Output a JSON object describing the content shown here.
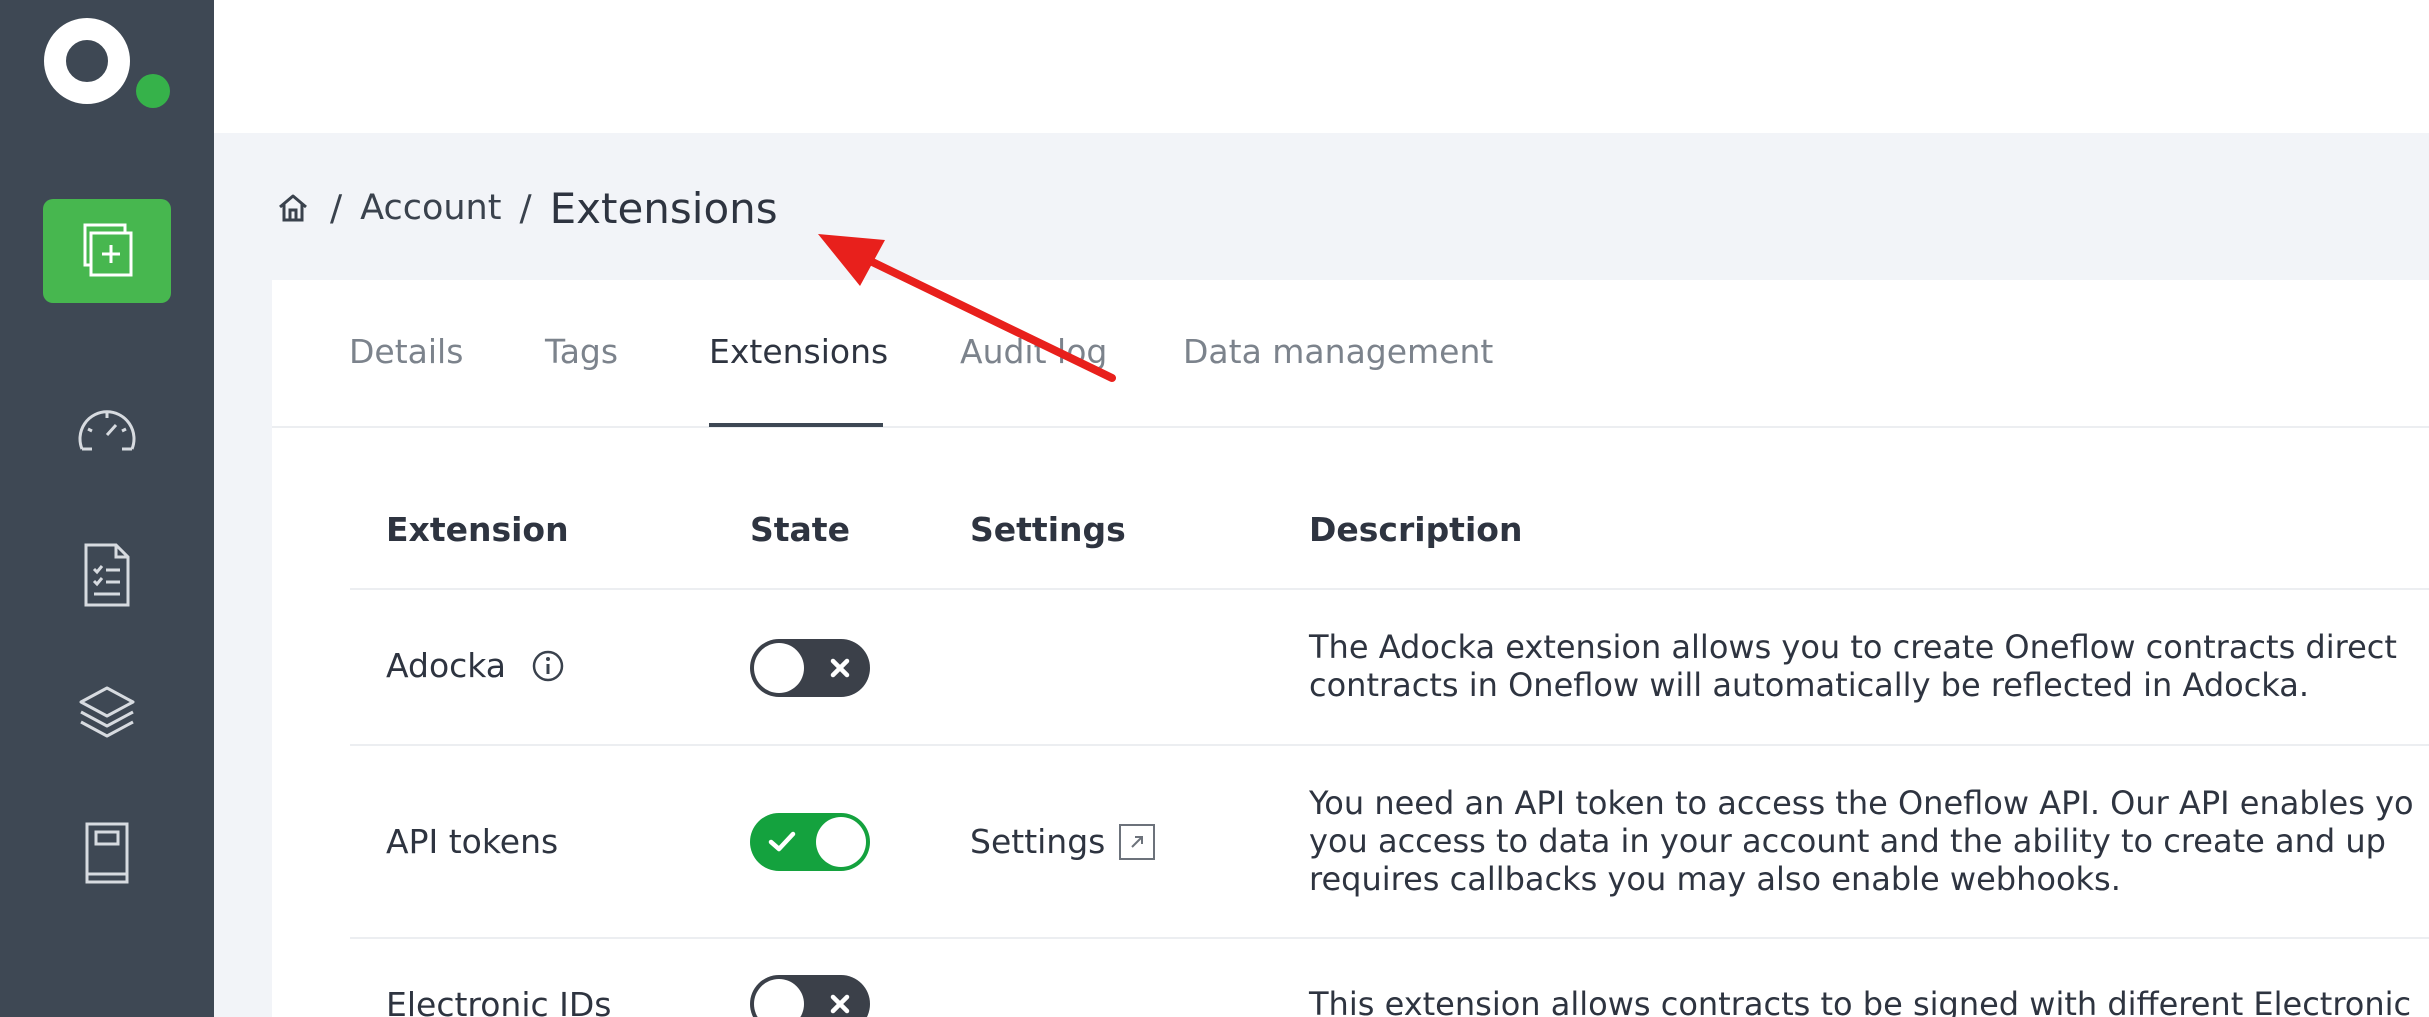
{
  "sidebar": {
    "icons": [
      "logo",
      "create-contract-icon",
      "dashboard-icon",
      "documents-icon",
      "templates-icon",
      "address-book-icon"
    ],
    "accent_color": "#47b74f"
  },
  "breadcrumb": {
    "home_icon": "home-icon",
    "items": [
      "Account",
      "Extensions"
    ],
    "separator": "/"
  },
  "tabs": [
    {
      "label": "Details",
      "active": false
    },
    {
      "label": "Tags",
      "active": false
    },
    {
      "label": "Extensions",
      "active": true
    },
    {
      "label": "Audit log",
      "active": false
    },
    {
      "label": "Data management",
      "active": false
    }
  ],
  "table": {
    "headers": [
      "Extension",
      "State",
      "Settings",
      "Description"
    ],
    "rows": [
      {
        "name": "Adocka",
        "has_info": true,
        "state": "off",
        "settings": "",
        "description": [
          "The Adocka extension allows you to create Oneflow contracts direct",
          "contracts in Oneflow will automatically be reflected in Adocka."
        ]
      },
      {
        "name": "API tokens",
        "has_info": false,
        "state": "on",
        "settings": "Settings",
        "description": [
          "You need an API token to access the Oneflow API. Our API enables yo",
          "you access to data in your account and the ability to create and up",
          "requires callbacks you may also enable webhooks."
        ]
      },
      {
        "name": "Electronic IDs",
        "has_info": false,
        "state": "off",
        "settings": "",
        "description": [
          "This extension allows contracts to be signed with different Electronic"
        ]
      }
    ]
  },
  "annotation": {
    "type": "arrow",
    "color": "#e8201c"
  }
}
